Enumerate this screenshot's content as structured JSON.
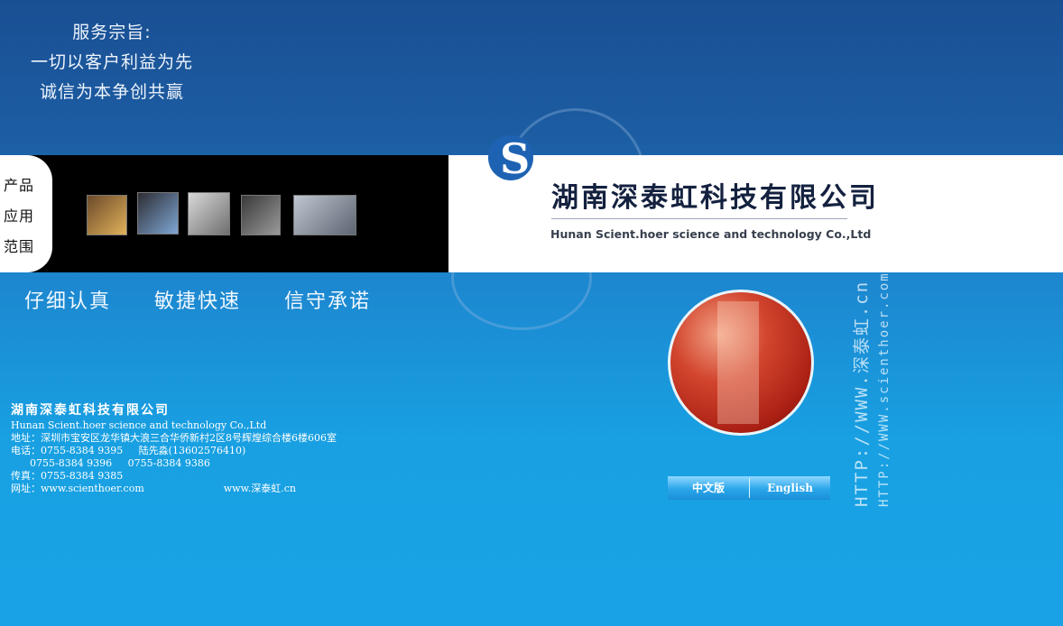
{
  "service": {
    "heading": "服务宗旨:",
    "line1": "一切以客户利益为先",
    "line2": "诚信为本争创共赢"
  },
  "products_tab": [
    "产品",
    "应用",
    "范围"
  ],
  "company": {
    "cn_name": "湖南深泰虹科技有限公司",
    "en_name": "Hunan Scient.hoer science and technology Co.,Ltd"
  },
  "slogans": [
    "仔细认真",
    "敏捷快速",
    "信守承诺"
  ],
  "contact": {
    "title": "湖南深泰虹科技有限公司",
    "en": "Hunan Scient.hoer science and technology Co.,Ltd",
    "address": "地址：深圳市宝安区龙华镇大浪三合华侨新村2区8号辉煌综合楼6楼606室",
    "phone": "电话：0755-8384 9395     陆先淼(13602576410)",
    "phone2": "      0755-8384 9396     0755-8384 9386",
    "fax": "传真：0755-8384 9385",
    "web": "网址：www.scienthoer.com",
    "web2": "www.深泰虹.cn"
  },
  "lang": {
    "cn": "中文版",
    "en": "English"
  },
  "vertical_urls": [
    "HTTP://WWW.深泰虹.cn",
    "HTTP://WWW.scienthoer.com"
  ]
}
